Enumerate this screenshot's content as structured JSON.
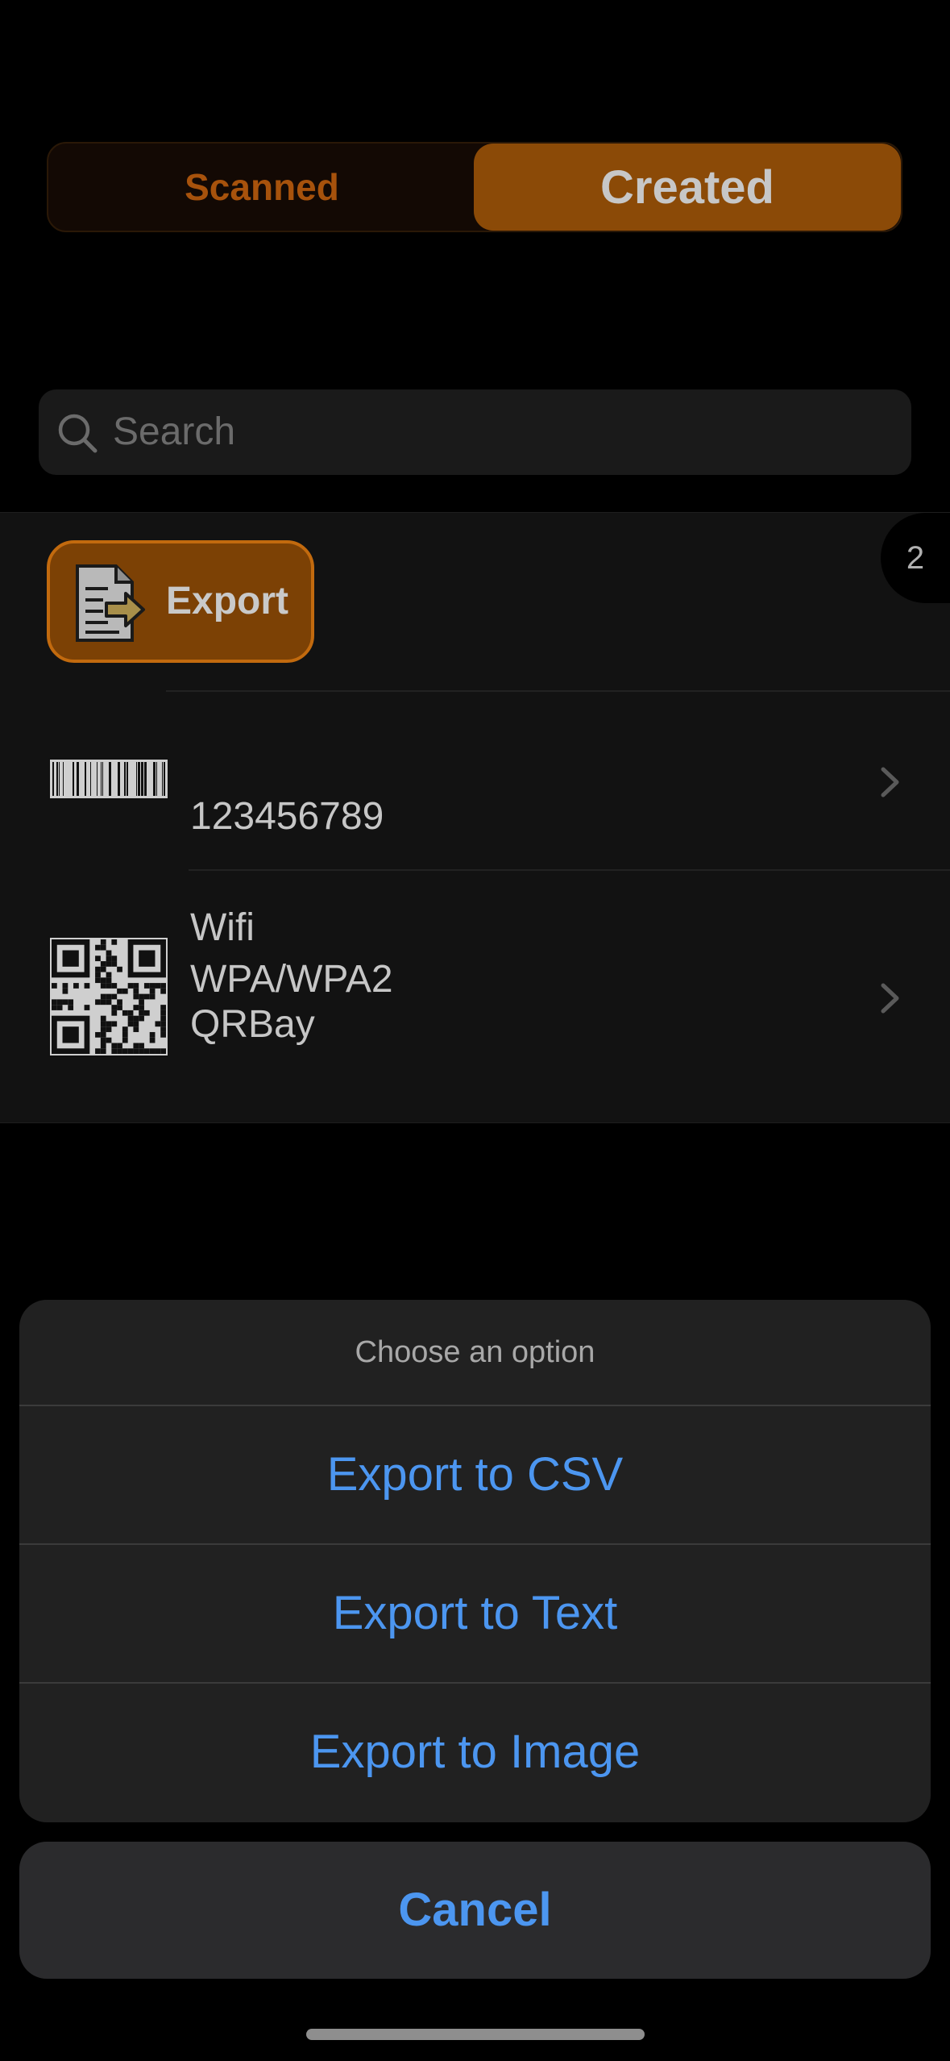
{
  "segments": {
    "scanned": "Scanned",
    "created": "Created",
    "selected": "Created"
  },
  "search": {
    "placeholder": "Search"
  },
  "toolbar": {
    "export_label": "Export",
    "count": "2"
  },
  "items": [
    {
      "type": "barcode",
      "lines": [
        "123456789"
      ]
    },
    {
      "type": "qr",
      "lines": [
        "Wifi",
        "WPA/WPA2",
        "QRBay"
      ]
    }
  ],
  "action_sheet": {
    "title": "Choose an option",
    "options": [
      "Export to CSV",
      "Export to Text",
      "Export to Image"
    ],
    "cancel": "Cancel"
  },
  "colors": {
    "accent": "#8b4a07",
    "link_blue": "#4c96f0"
  }
}
